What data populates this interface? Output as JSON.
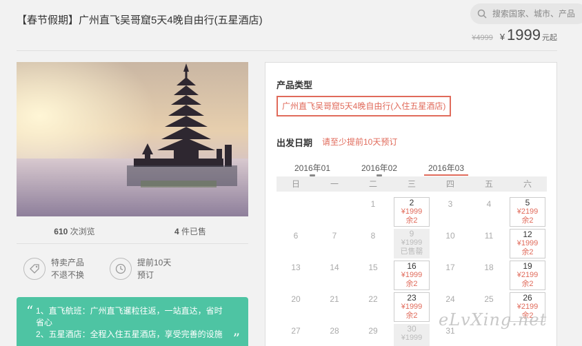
{
  "header": {
    "title": "【春节假期】广州直飞吴哥窟5天4晚自由行(五星酒店)",
    "search_placeholder": "搜索国家、城市、产品",
    "old_price": "¥4999",
    "currency": "¥",
    "price": "1999",
    "price_suffix": "元起"
  },
  "stats": {
    "views_count": "610",
    "views_label": "次浏览",
    "sold_count": "4",
    "sold_label": "件已售"
  },
  "features": [
    {
      "line1": "特卖产品",
      "line2": "不退不换",
      "icon": "tag-icon"
    },
    {
      "line1": "提前10天",
      "line2": "预订",
      "icon": "clock-icon"
    }
  ],
  "highlights": {
    "lines": [
      "1、直飞航班：广州直飞暹粒往返，一站直达，省时省心",
      "2、五星酒店：全程入住五星酒店，享受完善的设施"
    ]
  },
  "panel": {
    "type_heading": "产品类型",
    "type_option": "广州直飞吴哥窟5天4晚自由行(入住五星酒店)",
    "dep_heading": "出发日期",
    "dep_note": "请至少提前10天预订",
    "months": [
      "2016年01",
      "2016年02",
      "2016年03"
    ],
    "active_month": "2016年03",
    "weekdays": [
      "日",
      "一",
      "二",
      "三",
      "四",
      "五",
      "六"
    ]
  },
  "calendar": {
    "rows": [
      [
        {
          "d": ""
        },
        {
          "d": ""
        },
        {
          "d": "1"
        },
        {
          "d": "2",
          "price": "¥1999",
          "stock": "余2",
          "state": "avail"
        },
        {
          "d": "3"
        },
        {
          "d": "4"
        },
        {
          "d": "5",
          "price": "¥2199",
          "stock": "余2",
          "state": "avail"
        }
      ],
      [
        {
          "d": "6"
        },
        {
          "d": "7"
        },
        {
          "d": "8"
        },
        {
          "d": "9",
          "price": "¥1999",
          "stock": "已售罄",
          "state": "sold"
        },
        {
          "d": "10"
        },
        {
          "d": "11"
        },
        {
          "d": "12",
          "price": "¥1999",
          "stock": "余2",
          "state": "avail"
        }
      ],
      [
        {
          "d": "13"
        },
        {
          "d": "14"
        },
        {
          "d": "15"
        },
        {
          "d": "16",
          "price": "¥1999",
          "stock": "余2",
          "state": "avail"
        },
        {
          "d": "17"
        },
        {
          "d": "18"
        },
        {
          "d": "19",
          "price": "¥2199",
          "stock": "余2",
          "state": "avail"
        }
      ],
      [
        {
          "d": "20"
        },
        {
          "d": "21"
        },
        {
          "d": "22"
        },
        {
          "d": "23",
          "price": "¥1999",
          "stock": "余2",
          "state": "avail"
        },
        {
          "d": "24"
        },
        {
          "d": "25"
        },
        {
          "d": "26",
          "price": "¥2199",
          "stock": "余2",
          "state": "avail"
        }
      ],
      [
        {
          "d": "27"
        },
        {
          "d": "28"
        },
        {
          "d": "29"
        },
        {
          "d": "30",
          "price": "¥1999",
          "stock": "",
          "state": "sold"
        },
        {
          "d": "31"
        },
        {
          "d": ""
        },
        {
          "d": ""
        }
      ]
    ]
  },
  "watermark": "eLvXing.net",
  "colors": {
    "accent": "#e06a5a",
    "highlight_bg": "#4ec4a3"
  }
}
